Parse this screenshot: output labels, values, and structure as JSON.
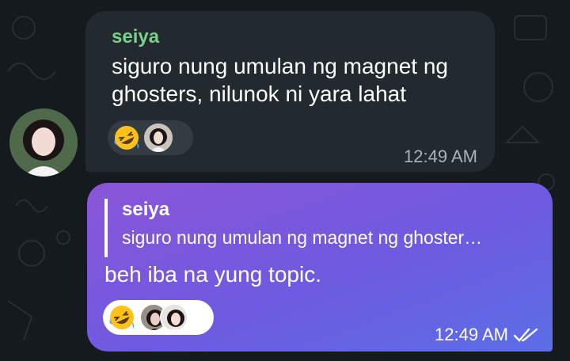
{
  "chat": {
    "incoming": {
      "sender": "seiya",
      "text": "siguro nung umulan ng magnet ng ghosters, nilunok ni yara lahat",
      "time": "12:49 AM",
      "reaction_emoji": "rolling-on-floor-laughing-icon"
    },
    "outgoing": {
      "reply_to_sender": "seiya",
      "reply_to_text": "siguro nung umulan ng magnet ng ghoster…",
      "text": "beh iba na yung topic.",
      "time": "12:49 AM",
      "status": "read",
      "reaction_emoji": "rolling-on-floor-laughing-icon"
    }
  },
  "colors": {
    "background": "#141a1d",
    "incoming_bubble": "#222a2f",
    "sender_name": "#79d088",
    "outgoing_gradient_start": "#8a55d8",
    "outgoing_gradient_end": "#5b6ee6"
  }
}
